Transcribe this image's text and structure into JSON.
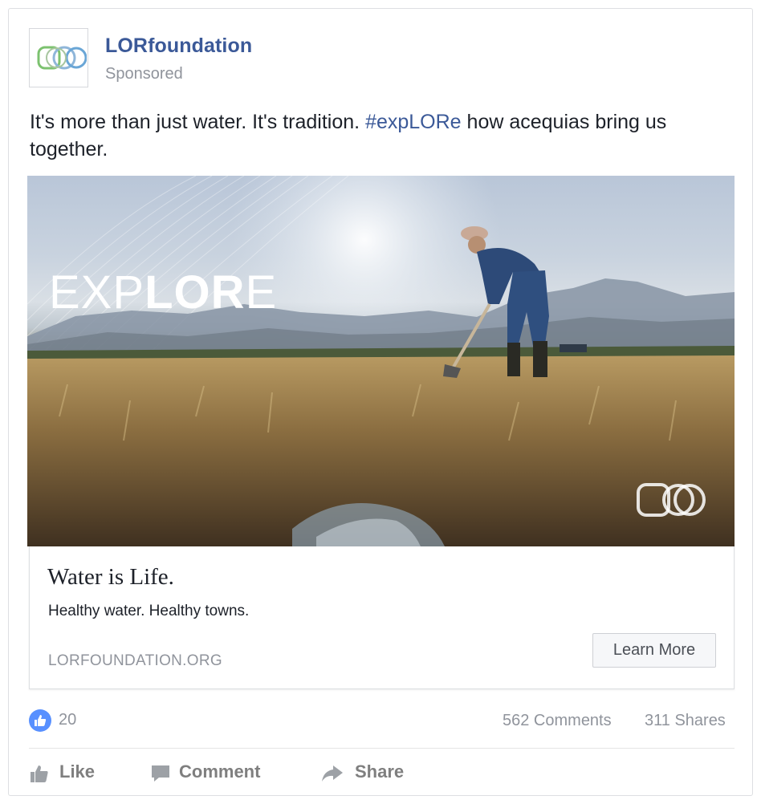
{
  "post": {
    "page_name": "LORfoundation",
    "sponsored_label": "Sponsored",
    "text_main": "It's more than just water. It's tradition. ",
    "text_hashtag": "#expLORe",
    "text_tail": " how acequias bring us together."
  },
  "hero": {
    "word_part1": "EXP",
    "word_part2": "LOR",
    "word_part3": "E"
  },
  "link_preview": {
    "title": "Water is Life.",
    "description": "Healthy water. Healthy towns.",
    "domain": "LORFOUNDATION.ORG",
    "cta_label": "Learn More"
  },
  "stats": {
    "likes": "20",
    "comments": "562 Comments",
    "shares": "311 Shares"
  },
  "actions": {
    "like": "Like",
    "comment": "Comment",
    "share": "Share"
  },
  "colors": {
    "brand_blue": "#3b5998",
    "like_badge": "#5890ff",
    "meta_gray": "#90949c"
  },
  "icons": [
    "lor-logo-icon",
    "like-badge-icon",
    "thumbs-up-icon",
    "comment-icon",
    "share-arrow-icon"
  ]
}
